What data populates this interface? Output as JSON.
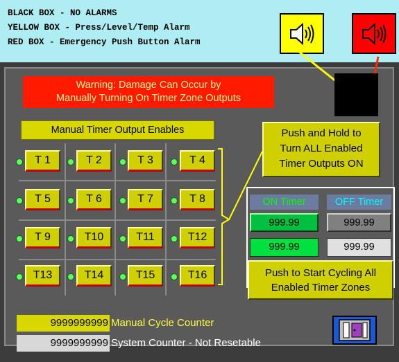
{
  "legend": {
    "line1": "BLACK BOX - NO ALARMS",
    "line2": "YELLOW BOX - Press/Level/Temp Alarm",
    "line3": "RED BOX - Emergency Push Button Alarm"
  },
  "alarm_buttons": {
    "yellow_icon": "speaker-icon",
    "red_icon": "speaker-icon",
    "yellow_color": "#ffff00",
    "red_color": "#ff0000",
    "indicator_color": "#000000"
  },
  "warning": {
    "line1": "Warning: Damage Can Occur by",
    "line2": "Manually Turning On Timer Zone Outputs"
  },
  "enables_label": "Manual Timer Output Enables",
  "timers": [
    "T 1",
    "T 2",
    "T 3",
    "T 4",
    "T 5",
    "T 6",
    "T 7",
    "T 8",
    "T 9",
    "T10",
    "T11",
    "T12",
    "T13",
    "T14",
    "T15",
    "T16"
  ],
  "push_hold": {
    "line1": "Push and Hold to",
    "line2": "Turn ALL Enabled",
    "line3": "Timer Outputs ON"
  },
  "on_timer": {
    "label": "ON Timer",
    "setpoint": "999.99",
    "actual": "999.99"
  },
  "off_timer": {
    "label": "OFF Timer",
    "setpoint": "999.99",
    "actual": "999.99"
  },
  "cycle_button": {
    "line1": "Push to Start Cycling All",
    "line2": "Enabled Timer Zones"
  },
  "counters": {
    "manual_value": "9999999999",
    "manual_label": "Manual Cycle Counter",
    "system_value": "9999999999",
    "system_label": "System Counter - Not Resetable"
  },
  "exit_icon": "door-exit-icon"
}
